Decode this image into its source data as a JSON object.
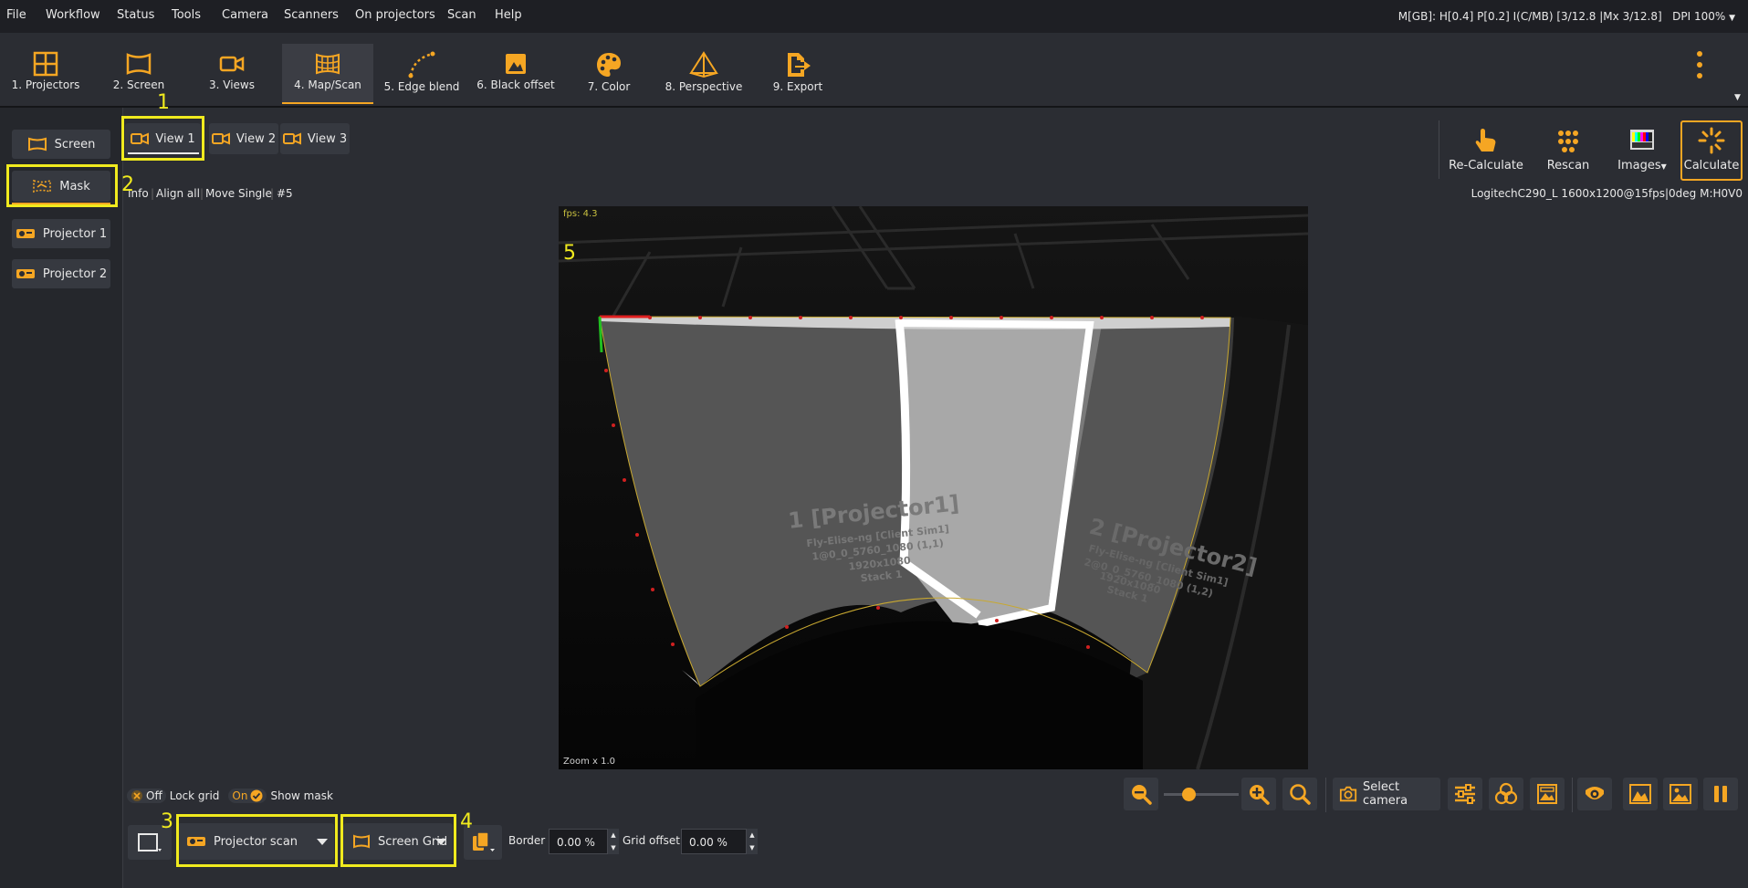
{
  "menu": {
    "items": [
      "File",
      "Workflow",
      "Status",
      "Tools",
      "Camera",
      "Scanners",
      "On projectors",
      "Scan",
      "Help"
    ],
    "status_text": "M[GB]: H[0.4] P[0.2] I(C/MB) [3/12.8 |Mx 3/12.8]",
    "dpi": "DPI 100%"
  },
  "toolbar": {
    "tabs": [
      {
        "label": "1. Projectors",
        "icon": "grid-icon"
      },
      {
        "label": "2. Screen",
        "icon": "screen-icon"
      },
      {
        "label": "3. Views",
        "icon": "camera-icon"
      },
      {
        "label": "4. Map/Scan",
        "icon": "map-grid-icon"
      },
      {
        "label": "5. Edge blend",
        "icon": "curve-icon"
      },
      {
        "label": "6. Black offset",
        "icon": "black-offset-icon"
      },
      {
        "label": "7. Color",
        "icon": "palette-icon"
      },
      {
        "label": "8. Perspective",
        "icon": "perspective-icon"
      },
      {
        "label": "9. Export",
        "icon": "export-icon"
      }
    ],
    "active": "4. Map/Scan"
  },
  "sidebar": {
    "items": [
      {
        "label": "Screen",
        "icon": "screen-icon"
      },
      {
        "label": "Mask",
        "icon": "mask-icon"
      },
      {
        "label": "Projector 1",
        "icon": "projector-icon"
      },
      {
        "label": "Projector 2",
        "icon": "projector-icon"
      }
    ]
  },
  "views": {
    "tabs": [
      "View 1",
      "View 2",
      "View 3"
    ],
    "active": "View 1"
  },
  "actions": {
    "recalculate": "Re-Calculate",
    "rescan": "Rescan",
    "images": "Images",
    "calculate": "Calculate"
  },
  "subbar": {
    "items": [
      "Info",
      "Align all",
      "Move Single",
      "#5"
    ],
    "camera_info": "LogitechC290_L 1600x1200@15fps|0deg M:H0V0"
  },
  "viewport": {
    "fps": "fps: 4.3",
    "zoom": "Zoom x 1.0",
    "projector1_title": "1 [Projector1]",
    "projector1_lines": [
      "Fly-Elise-ng [Client Sim1]",
      "1@0_0_5760_1080 (1,1)",
      "1920x1080",
      "Stack 1"
    ],
    "projector2_title": "2 [Projector2]",
    "projector2_lines": [
      "Fly-Elise-ng [Client Sim1]",
      "2@0_0_5760_1080 (1,2)",
      "1920x1080",
      "Stack 1"
    ]
  },
  "controls": {
    "lock_toggle": "Off",
    "lock_label": "Lock grid",
    "mask_toggle": "On",
    "mask_label": "Show mask",
    "select_camera": "Select camera",
    "zoom_level": 0.3,
    "scan_mode": "Projector scan",
    "grid_mode": "Screen Grid",
    "border_label": "Border",
    "border_value": "0.00 %",
    "grid_offset_label": "Grid offset",
    "grid_offset_value": "0.00 %"
  },
  "annotations": [
    "1",
    "2",
    "3",
    "4",
    "5"
  ],
  "colors": {
    "accent": "#f5a623",
    "highlight": "#f0ea1e",
    "background": "#2b2d33"
  }
}
